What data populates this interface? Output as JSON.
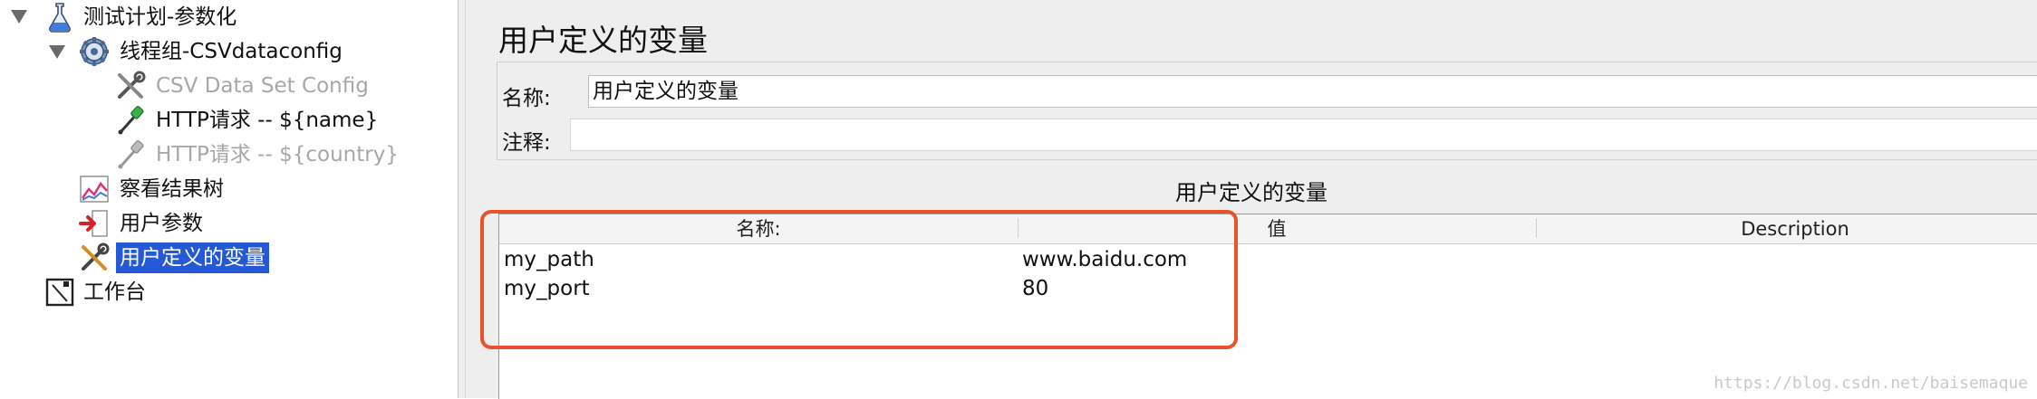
{
  "tree": {
    "items": [
      {
        "label": "测试计划-参数化",
        "icon": "flask-icon",
        "state": "normal"
      },
      {
        "label": "线程组-CSVdataconfig",
        "icon": "gear-icon",
        "state": "normal"
      },
      {
        "label": "CSV Data Set Config",
        "icon": "wrench-screwdriver-icon",
        "state": "disabled"
      },
      {
        "label": "HTTP请求 -- ${name}",
        "icon": "pipette-icon",
        "state": "normal"
      },
      {
        "label": "HTTP请求 -- ${country}",
        "icon": "pipette-icon",
        "state": "disabled"
      },
      {
        "label": "察看结果树",
        "icon": "chart-icon",
        "state": "normal"
      },
      {
        "label": "用户参数",
        "icon": "arrow-in-icon",
        "state": "normal"
      },
      {
        "label": "用户定义的变量",
        "icon": "wrench-screwdriver-icon",
        "state": "selected"
      },
      {
        "label": "工作台",
        "icon": "workbench-icon",
        "state": "normal"
      }
    ]
  },
  "panel": {
    "title": "用户定义的变量",
    "name_label": "名称:",
    "name_value": "用户定义的变量",
    "comment_label": "注释:",
    "comment_value": "",
    "table_caption": "用户定义的变量",
    "columns": [
      "名称:",
      "值",
      "Description"
    ],
    "rows": [
      {
        "name": "my_path",
        "value": "www.baidu.com",
        "description": ""
      },
      {
        "name": "my_port",
        "value": "80",
        "description": ""
      }
    ]
  },
  "watermark": "https://blog.csdn.net/baisemaque",
  "colors": {
    "selection": "#2458d6",
    "highlight_border": "#e8532b",
    "disabled_text": "#a7a7a7"
  }
}
